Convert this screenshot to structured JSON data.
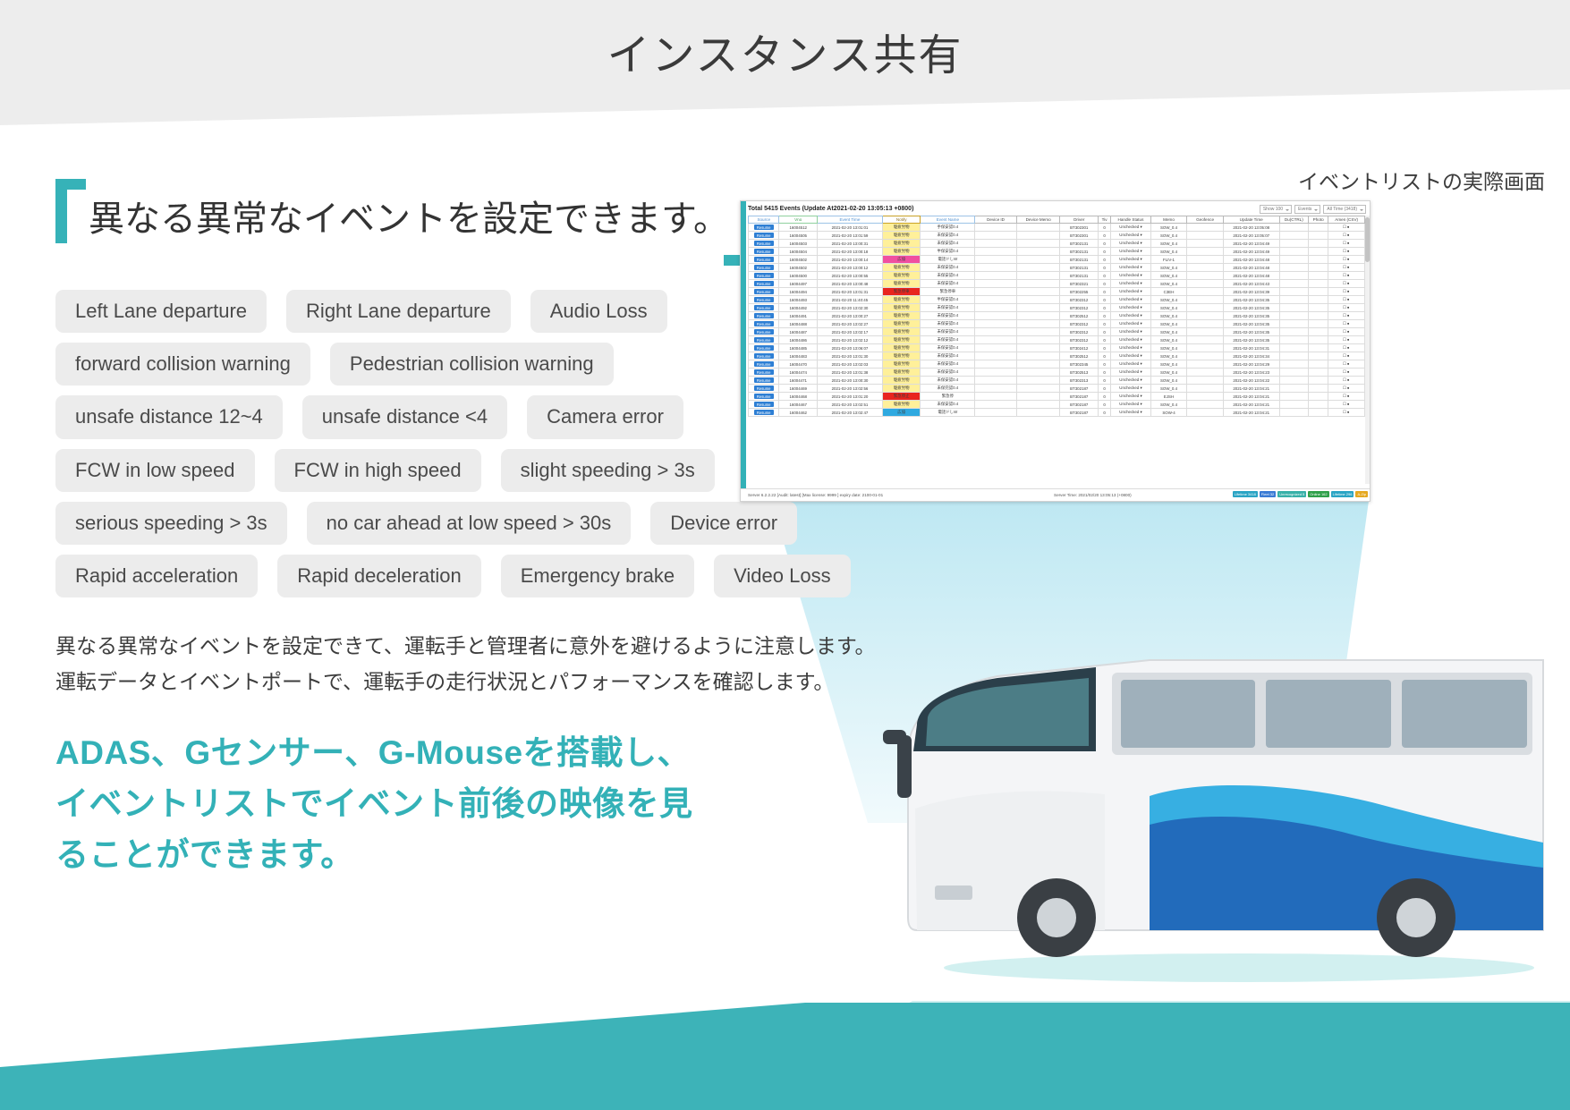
{
  "page": {
    "title": "インスタンス共有"
  },
  "quote": {
    "text": "異なる異常なイベントを設定できます。"
  },
  "pill_rows": [
    [
      "Left Lane departure",
      "Right Lane departure",
      "Audio Loss"
    ],
    [
      "forward collision warning",
      "Pedestrian collision warning"
    ],
    [
      "unsafe distance 12~4",
      "unsafe distance <4",
      "Camera error"
    ],
    [
      "FCW in low speed",
      "FCW in high speed",
      "slight speeding > 3s"
    ],
    [
      "serious speeding > 3s",
      "no car ahead at low speed > 30s",
      "Device error"
    ],
    [
      "Rapid acceleration",
      "Rapid deceleration",
      "Emergency brake",
      "Video Loss"
    ]
  ],
  "body_paragraph": [
    "異なる異常なイベントを設定できて、運転手と管理者に意外を避けるように注意します。",
    "運転データとイベントポートで、運転手の走行状況とパフォーマンスを確認します。"
  ],
  "teal_block": [
    "ADAS、Gセンサー、G-Mouseを搭載し、",
    "イベントリストでイベント前後の映像を見",
    "ることができます。"
  ],
  "screenshot": {
    "caption": "イベントリストの実際画面",
    "summary": "Total 5415 Events (Update At2021-02-20 13:05:13 +0800)",
    "toolbar": [
      "Show 100",
      "Events",
      "All Time (3418)"
    ],
    "columns": [
      "Source",
      "Vno",
      "Event Time",
      "Notify",
      "Event Name",
      "Device ID",
      "Device Memo",
      "Driver",
      "Tiv",
      "Handle Status",
      "Memo",
      "Geofence",
      "Update Time",
      "Du(CTRL)",
      "Photo",
      "Amen (CSV)"
    ],
    "rows": [
      {
        "source": "Resume",
        "vno": "16004512",
        "time": "2021-02-20 13:01:01",
        "notify": "駆疲労物",
        "event": "手保安認0.4",
        "devid": "BT302301",
        "tiv": "0",
        "handle": "Unchecked",
        "memo": "SOW_0.4",
        "update": "2021-02-20 13:05:08",
        "flag": ""
      },
      {
        "source": "Resume",
        "vno": "16004505",
        "time": "2021-02-20 13:01:59",
        "notify": "駆疲労物",
        "event": "未保安認0.4",
        "devid": "BT302301",
        "tiv": "0",
        "handle": "Unchecked",
        "memo": "SOW_0.4",
        "update": "2021-02-20 13:05:07",
        "flag": ""
      },
      {
        "source": "Resume",
        "vno": "16004503",
        "time": "2021-02-20 13:00:31",
        "notify": "駆疲労物",
        "event": "未保安認0.4",
        "devid": "BT302131",
        "tiv": "0",
        "handle": "Unchecked",
        "memo": "SOW_0.4",
        "update": "2021-02-20 13:04:49",
        "flag": ""
      },
      {
        "source": "Resume",
        "vno": "16004504",
        "time": "2021-02-20 13:00:18",
        "notify": "駆疲労物",
        "event": "半保安認0.4",
        "devid": "BT302131",
        "tiv": "0",
        "handle": "Unchecked",
        "memo": "SOW_0.4",
        "update": "2021-02-20 13:04:49",
        "flag": ""
      },
      {
        "source": "Resume",
        "vno": "16004502",
        "time": "2021-02-20 13:00:14",
        "notify": "広協",
        "event": "電話ドしW",
        "devid": "BT302131",
        "tiv": "0",
        "handle": "Unchecked",
        "memo": "FLIV-1",
        "update": "2021-02-20 13:04:48",
        "flag": "pink"
      },
      {
        "source": "Resume",
        "vno": "16004502",
        "time": "2021-02-20 13:00:12",
        "notify": "駆疲労物",
        "event": "未保安認0.4",
        "devid": "BT302131",
        "tiv": "0",
        "handle": "Unchecked",
        "memo": "SOW_0.4",
        "update": "2021-02-20 13:04:48",
        "flag": ""
      },
      {
        "source": "Resume",
        "vno": "16004500",
        "time": "2021-02-20 13:00:55",
        "notify": "駆疲労物",
        "event": "未保安認0.4",
        "devid": "BT302131",
        "tiv": "0",
        "handle": "Unchecked",
        "memo": "SOW_0.4",
        "update": "2021-02-20 13:04:48",
        "flag": ""
      },
      {
        "source": "Resume",
        "vno": "16004497",
        "time": "2021-02-20 13:00:48",
        "notify": "駆疲労物",
        "event": "未保安認0.4",
        "devid": "BT302321",
        "tiv": "0",
        "handle": "Unchecked",
        "memo": "SOW_0.4",
        "update": "2021-02-20 13:04:43",
        "flag": ""
      },
      {
        "source": "Resume",
        "vno": "16004494",
        "time": "2021-02-20 13:01:31",
        "notify": "緊急停車",
        "event": "緊急停車",
        "devid": "BT302255",
        "tiv": "0",
        "handle": "Unchecked",
        "memo": "C3EH",
        "update": "2021-02-20 13:04:39",
        "flag": "red"
      },
      {
        "source": "Resume",
        "vno": "16004493",
        "time": "2021-02-20 11:40:45",
        "notify": "駆疲労物",
        "event": "半保安認0.4",
        "devid": "BT302312",
        "tiv": "0",
        "handle": "Unchecked",
        "memo": "SOW_0.4",
        "update": "2021-02-20 13:04:35",
        "flag": ""
      },
      {
        "source": "Resume",
        "vno": "16004492",
        "time": "2021-02-20 13:02:30",
        "notify": "駆疲労物",
        "event": "未保安認0.4",
        "devid": "BT302312",
        "tiv": "0",
        "handle": "Unchecked",
        "memo": "SOW_0.4",
        "update": "2021-02-20 13:04:35",
        "flag": ""
      },
      {
        "source": "Resume",
        "vno": "16004491",
        "time": "2021-02-20 13:00:27",
        "notify": "駆疲労物",
        "event": "未保安認0.4",
        "devid": "BT302512",
        "tiv": "0",
        "handle": "Unchecked",
        "memo": "SOW_0.4",
        "update": "2021-02-20 13:04:35",
        "flag": ""
      },
      {
        "source": "Resume",
        "vno": "16004488",
        "time": "2021-02-20 13:02:27",
        "notify": "駆疲労物",
        "event": "未保安認0.4",
        "devid": "BT302312",
        "tiv": "0",
        "handle": "Unchecked",
        "memo": "SOW_0.4",
        "update": "2021-02-20 13:04:35",
        "flag": ""
      },
      {
        "source": "Resume",
        "vno": "16004487",
        "time": "2021-02-20 13:02:17",
        "notify": "駆疲労物",
        "event": "未保安認0.4",
        "devid": "BT302312",
        "tiv": "0",
        "handle": "Unchecked",
        "memo": "SOW_0.4",
        "update": "2021-02-20 13:04:35",
        "flag": ""
      },
      {
        "source": "Resume",
        "vno": "16004486",
        "time": "2021-02-20 13:02:12",
        "notify": "駆疲労物",
        "event": "未保安認0.4",
        "devid": "BT302312",
        "tiv": "0",
        "handle": "Unchecked",
        "memo": "SOW_0.4",
        "update": "2021-02-20 13:04:35",
        "flag": ""
      },
      {
        "source": "Resume",
        "vno": "16004485",
        "time": "2021-02-20 13:06:07",
        "notify": "駆疲労物",
        "event": "未保安認0.4",
        "devid": "BT302412",
        "tiv": "0",
        "handle": "Unchecked",
        "memo": "SOW_0.4",
        "update": "2021-02-20 13:04:31",
        "flag": ""
      },
      {
        "source": "Resume",
        "vno": "16004483",
        "time": "2021-02-20 13:01:30",
        "notify": "駆疲労物",
        "event": "未保安認0.4",
        "devid": "BT302512",
        "tiv": "0",
        "handle": "Unchecked",
        "memo": "SOW_0.4",
        "update": "2021-02-20 13:04:34",
        "flag": ""
      },
      {
        "source": "Resume",
        "vno": "16004470",
        "time": "2021-02-20 13:02:03",
        "notify": "駆疲労物",
        "event": "未保安認0.4",
        "devid": "BT302345",
        "tiv": "0",
        "handle": "Unchecked",
        "memo": "SOW_0.4",
        "update": "2021-02-20 13:04:29",
        "flag": ""
      },
      {
        "source": "Resume",
        "vno": "16004474",
        "time": "2021-02-20 13:01:38",
        "notify": "駆疲労物",
        "event": "未保安認0.4",
        "devid": "BT302513",
        "tiv": "0",
        "handle": "Unchecked",
        "memo": "SOW_0.4",
        "update": "2021-02-20 13:04:23",
        "flag": ""
      },
      {
        "source": "Resume",
        "vno": "16004471",
        "time": "2021-02-20 13:00:30",
        "notify": "駆疲労物",
        "event": "未保安認0.4",
        "devid": "BT302313",
        "tiv": "0",
        "handle": "Unchecked",
        "memo": "SOW_0.4",
        "update": "2021-02-20 13:04:22",
        "flag": ""
      },
      {
        "source": "Resume",
        "vno": "16004469",
        "time": "2021-02-20 13:02:56",
        "notify": "駆疲労物",
        "event": "未保完認0.4",
        "devid": "BT302187",
        "tiv": "0",
        "handle": "Unchecked",
        "memo": "SOW_0.4",
        "update": "2021-02-20 13:04:21",
        "flag": ""
      },
      {
        "source": "Resume",
        "vno": "16004468",
        "time": "2021-02-20 13:01:20",
        "notify": "緊急停止",
        "event": "緊急停",
        "devid": "BT302187",
        "tiv": "0",
        "handle": "Unchecked",
        "memo": "EJSH",
        "update": "2021-02-20 13:04:21",
        "flag": "red"
      },
      {
        "source": "Resume",
        "vno": "16004467",
        "time": "2021-02-20 13:02:51",
        "notify": "駆疲労物",
        "event": "未保安認0.4",
        "devid": "BT302187",
        "tiv": "0",
        "handle": "Unchecked",
        "memo": "SOW_0.4",
        "update": "2021-02-20 13:04:21",
        "flag": ""
      },
      {
        "source": "Resume",
        "vno": "16004462",
        "time": "2021-02-20 13:02:47",
        "notify": "広協",
        "event": "電話ドしW",
        "devid": "BT302187",
        "tiv": "0",
        "handle": "Unchecked",
        "memo": "SOW-4",
        "update": "2021-02-20 13:04:21",
        "flag": "blue"
      }
    ],
    "footer_left": "Server 6.2.2.22 [Audit: latest] [Max license: 9999 ] expiry date: 2100-01-01",
    "footer_mid": "Server Time: 2021/02/20 13:05:13 (+0800)",
    "footer_chips": [
      {
        "label": "Lifetime",
        "value": "3418",
        "color": "#2aa4c4"
      },
      {
        "label": "Fleet",
        "value": "32",
        "color": "#3a7bd5"
      },
      {
        "label": "Unrecognized",
        "value": "5",
        "color": "#37b0a8"
      },
      {
        "label": "Online",
        "value": "162",
        "color": "#2fa04a"
      },
      {
        "label": "Lifetime",
        "value": "296",
        "color": "#2aa4c4"
      },
      {
        "label": "A-Zip",
        "value": "",
        "color": "#e5a820"
      }
    ]
  },
  "colors": {
    "accent_teal": "#33b1b7",
    "pill_bg": "#ececec",
    "band_grey": "#ededed"
  }
}
